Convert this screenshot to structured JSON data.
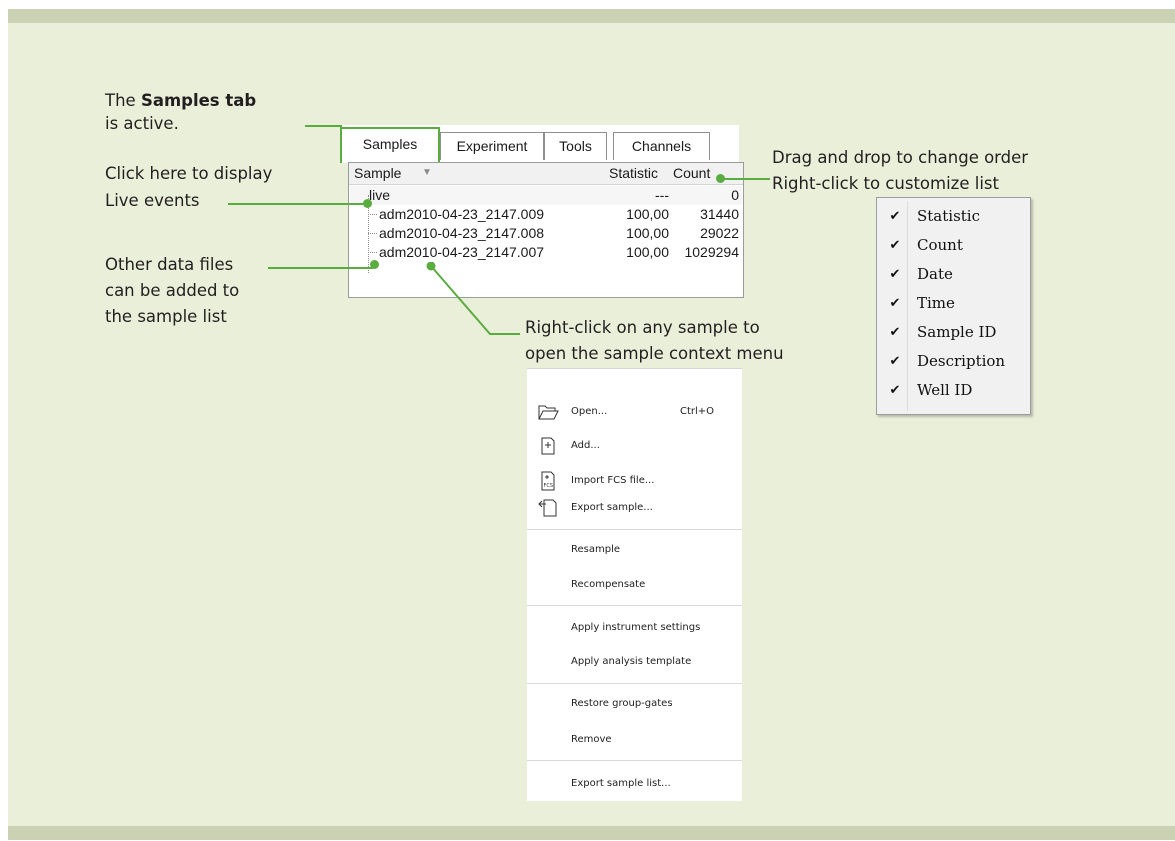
{
  "annotations": {
    "samples_tab_prefix": "The ",
    "samples_tab_bold": "Samples tab",
    "samples_tab_suffix": "is active.",
    "live_line1": "Click here to display",
    "live_line2": "Live events",
    "other_line1": "Other data files",
    "other_line2": "can be added to",
    "other_line3": "the sample list",
    "drag_line": "Drag and drop to change order",
    "rightclick_line": "Right-click to customize list",
    "context_line1": "Right-click on any sample to",
    "context_line2": "open the sample context menu"
  },
  "tabs": [
    "Samples",
    "Experiment",
    "Tools",
    "Channels"
  ],
  "list": {
    "headers": {
      "sample": "Sample",
      "statistic": "Statistic",
      "count": "Count"
    },
    "sort_icon": "sort-desc-icon",
    "rows": [
      {
        "name": "live",
        "statistic": "---",
        "count": "0"
      },
      {
        "name": "adm2010-04-23_2147.009",
        "statistic": "100,00",
        "count": "31440"
      },
      {
        "name": "adm2010-04-23_2147.008",
        "statistic": "100,00",
        "count": "29022"
      },
      {
        "name": "adm2010-04-23_2147.007",
        "statistic": "100,00",
        "count": "1029294"
      }
    ]
  },
  "column_menu": {
    "check_icon": "check-icon",
    "items": [
      "Statistic",
      "Count",
      "Date",
      "Time",
      "Sample ID",
      "Description",
      "Well ID"
    ]
  },
  "context_menu": {
    "items": [
      {
        "label": "Open...",
        "shortcut": "Ctrl+O",
        "icon": "folder-icon"
      },
      {
        "label": "Add...",
        "icon": "add-file-icon"
      },
      {
        "label": "Import FCS file...",
        "icon": "import-fcs-icon"
      },
      {
        "label": "Export sample...",
        "icon": "export-icon"
      },
      {
        "label": "Resample"
      },
      {
        "label": "Recompensate"
      },
      {
        "label": "Apply instrument settings"
      },
      {
        "label": "Apply analysis template"
      },
      {
        "label": "Restore group-gates"
      },
      {
        "label": "Remove"
      },
      {
        "label": "Export sample list..."
      }
    ]
  },
  "colors": {
    "accent_green": "#5aac3f",
    "panel_bg": "#e9efd9",
    "frame_bar": "#cbd2b3"
  }
}
